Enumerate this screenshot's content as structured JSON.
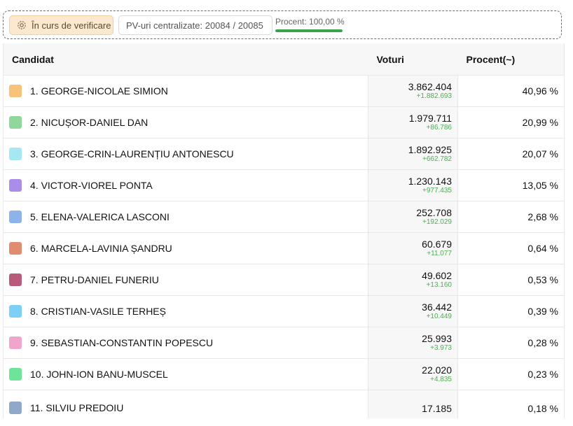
{
  "status": {
    "badge_label": "În curs de verificare",
    "pv_label": "PV-uri centralizate: 20084 / 20085",
    "procent_label": "Procent: 100,00 %",
    "procent_value": 1.0,
    "progress_color": "#3aa34a"
  },
  "table": {
    "headers": {
      "candidate": "Candidat",
      "votes": "Voturi",
      "percent": "Procent(~)"
    },
    "rows": [
      {
        "name": "1. GEORGE-NICOLAE SIMION",
        "votes": "3.862.404",
        "delta": "+1.882.693",
        "percent": "40,96 %",
        "color": "#f9c27a"
      },
      {
        "name": "2. NICUȘOR-DANIEL DAN",
        "votes": "1.979.711",
        "delta": "+86.786",
        "percent": "20,99 %",
        "color": "#8fd79a"
      },
      {
        "name": "3. GEORGE-CRIN-LAURENȚIU ANTONESCU",
        "votes": "1.892.925",
        "delta": "+662.782",
        "percent": "20,07 %",
        "color": "#a5e7f2"
      },
      {
        "name": "4. VICTOR-VIOREL PONTA",
        "votes": "1.230.143",
        "delta": "+977.435",
        "percent": "13,05 %",
        "color": "#a98de8"
      },
      {
        "name": "5. ELENA-VALERICA LASCONI",
        "votes": "252.708",
        "delta": "+192.029",
        "percent": "2,68 %",
        "color": "#8db4e8"
      },
      {
        "name": "6. MARCELA-LAVINIA ȘANDRU",
        "votes": "60.679",
        "delta": "+11.077",
        "percent": "0,64 %",
        "color": "#e08c6e"
      },
      {
        "name": "7. PETRU-DANIEL FUNERIU",
        "votes": "49.602",
        "delta": "+13.160",
        "percent": "0,53 %",
        "color": "#b85a7a"
      },
      {
        "name": "8. CRISTIAN-VASILE TERHEȘ",
        "votes": "36.442",
        "delta": "+10.449",
        "percent": "0,39 %",
        "color": "#7dd0f5"
      },
      {
        "name": "9. SEBASTIAN-CONSTANTIN POPESCU",
        "votes": "25.993",
        "delta": "+3.973",
        "percent": "0,28 %",
        "color": "#f0a6cc"
      },
      {
        "name": "10. JOHN-ION BANU-MUSCEL",
        "votes": "22.020",
        "delta": "+4.835",
        "percent": "0,23 %",
        "color": "#6ee39a"
      },
      {
        "name": "11. SILVIU PREDOIU",
        "votes": "17.185",
        "delta": "",
        "percent": "0,18 %",
        "color": "#8fa8cc"
      }
    ]
  }
}
